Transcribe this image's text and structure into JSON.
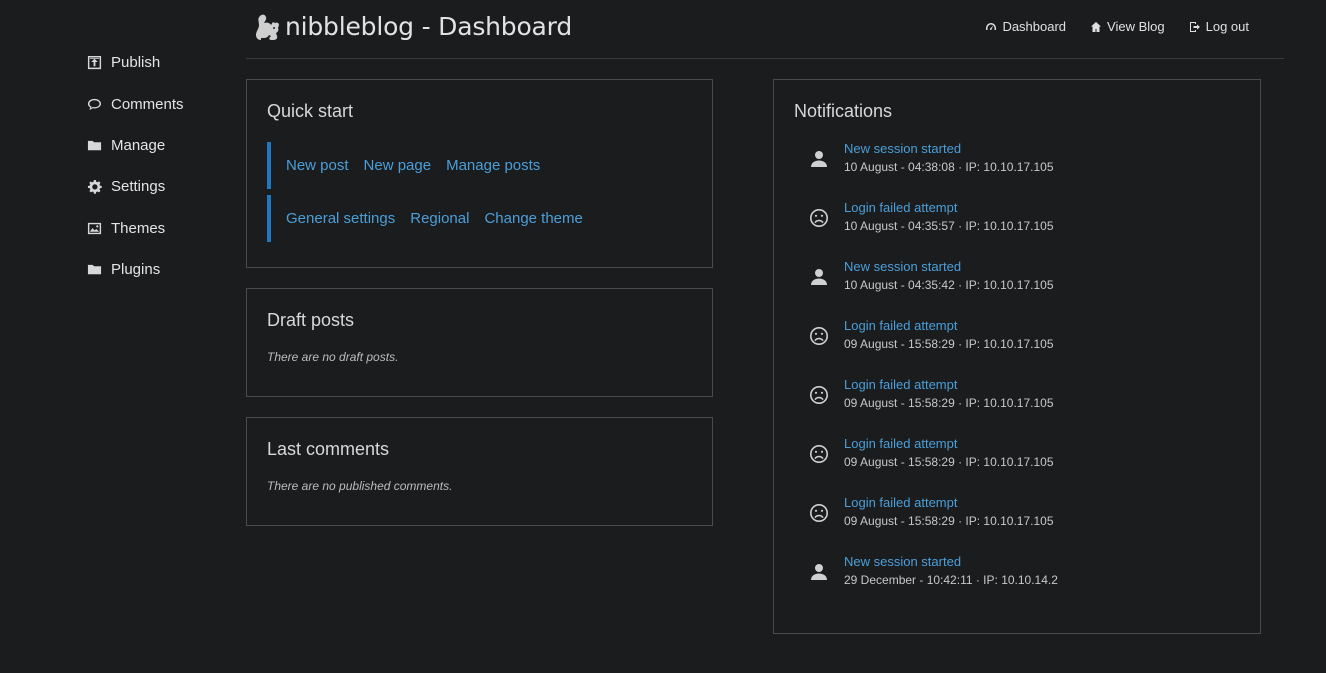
{
  "header": {
    "title": "nibbleblog - Dashboard",
    "nav": [
      {
        "label": "Dashboard",
        "icon": "dashboard-icon"
      },
      {
        "label": "View Blog",
        "icon": "home-icon"
      },
      {
        "label": "Log out",
        "icon": "logout-icon"
      }
    ]
  },
  "sidebar": {
    "items": [
      {
        "label": "Publish",
        "icon": "publish-icon"
      },
      {
        "label": "Comments",
        "icon": "comment-icon"
      },
      {
        "label": "Manage",
        "icon": "folder-icon"
      },
      {
        "label": "Settings",
        "icon": "gear-icon"
      },
      {
        "label": "Themes",
        "icon": "image-icon"
      },
      {
        "label": "Plugins",
        "icon": "folder-icon"
      }
    ]
  },
  "quick_start": {
    "title": "Quick start",
    "row1": [
      "New post",
      "New page",
      "Manage posts"
    ],
    "row2": [
      "General settings",
      "Regional",
      "Change theme"
    ]
  },
  "drafts": {
    "title": "Draft posts",
    "empty": "There are no draft posts."
  },
  "comments": {
    "title": "Last comments",
    "empty": "There are no published comments."
  },
  "notifications": {
    "title": "Notifications",
    "items": [
      {
        "icon": "user-icon",
        "title": "New session started",
        "meta": "10 August - 04:38:08 · IP: 10.10.17.105"
      },
      {
        "icon": "sad-face-icon",
        "title": "Login failed attempt",
        "meta": "10 August - 04:35:57 · IP: 10.10.17.105"
      },
      {
        "icon": "user-icon",
        "title": "New session started",
        "meta": "10 August - 04:35:42 · IP: 10.10.17.105"
      },
      {
        "icon": "sad-face-icon",
        "title": "Login failed attempt",
        "meta": "09 August - 15:58:29 · IP: 10.10.17.105"
      },
      {
        "icon": "sad-face-icon",
        "title": "Login failed attempt",
        "meta": "09 August - 15:58:29 · IP: 10.10.17.105"
      },
      {
        "icon": "sad-face-icon",
        "title": "Login failed attempt",
        "meta": "09 August - 15:58:29 · IP: 10.10.17.105"
      },
      {
        "icon": "sad-face-icon",
        "title": "Login failed attempt",
        "meta": "09 August - 15:58:29 · IP: 10.10.17.105"
      },
      {
        "icon": "user-icon",
        "title": "New session started",
        "meta": "29 December - 10:42:11 · IP: 10.10.14.2"
      }
    ]
  }
}
